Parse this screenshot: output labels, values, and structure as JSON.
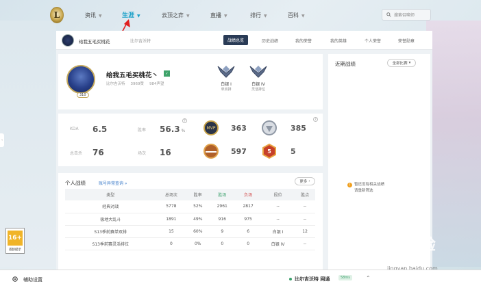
{
  "nav": {
    "logo": "L",
    "items": [
      {
        "label": "资讯"
      },
      {
        "label": "生涯"
      },
      {
        "label": "云顶之弈"
      },
      {
        "label": "直播"
      },
      {
        "label": "排行"
      },
      {
        "label": "百科"
      }
    ],
    "search_placeholder": "搜索召唤师"
  },
  "subnav": {
    "player_name": "给我五毛买桃花",
    "server": "比尔吉沃特",
    "tabs": [
      "战绩总览",
      "历史战绩",
      "我的荣誉",
      "我的英雄",
      "个人荣誉",
      "荣誉勋章"
    ]
  },
  "profile": {
    "name": "给我五毛买桃花丶",
    "level": "310",
    "server": "比尔吉沃特",
    "stat1": "3969赞",
    "stat2": "984声望",
    "ranks": [
      {
        "tier": "白银 I",
        "queue": "单双排"
      },
      {
        "tier": "白银 IV",
        "queue": "灵活排位"
      }
    ]
  },
  "stats": {
    "kda_label": "KDA",
    "kda": "6.5",
    "winrate_label": "胜率",
    "winrate": "56.3",
    "winrate_unit": "%",
    "total_label": "总击杀",
    "total": "76",
    "games_label": "场次",
    "games": "16",
    "medals": [
      {
        "name": "mvp",
        "value": "363"
      },
      {
        "name": "silver",
        "value": "385"
      },
      {
        "name": "legendary",
        "value": "597"
      },
      {
        "name": "pentakill",
        "value": "5"
      }
    ]
  },
  "personal": {
    "title": "个人战绩",
    "link": "账号异常查询 »",
    "more": "更多",
    "headers": [
      "类型",
      "总场次",
      "胜率",
      "胜场",
      "负场",
      "段位",
      "胜点"
    ],
    "rows": [
      [
        "经典对战",
        "5778",
        "52%",
        "2961",
        "2817",
        "--",
        "--"
      ],
      [
        "极地大乱斗",
        "1891",
        "49%",
        "916",
        "975",
        "--",
        "--"
      ],
      [
        "S13季前赛单双排",
        "15",
        "60%",
        "9",
        "6",
        "白银 I",
        "12"
      ],
      [
        "S13季前赛灵活排位",
        "0",
        "0%",
        "0",
        "0",
        "白银 IV",
        "--"
      ]
    ]
  },
  "recent": {
    "title": "近期战绩",
    "filter": "全部比赛",
    "empty_line1": "暂还没有相关战绩",
    "empty_line2": "请重新筛选"
  },
  "age": {
    "num": "16+",
    "label": "适龄提示"
  },
  "bottom": {
    "settings": "辅助设置",
    "server": "比尔吉沃特 网通",
    "ping": "58ms"
  },
  "watermark": {
    "main": "Bai 经验",
    "sub": "jingyan.baidu.com"
  }
}
